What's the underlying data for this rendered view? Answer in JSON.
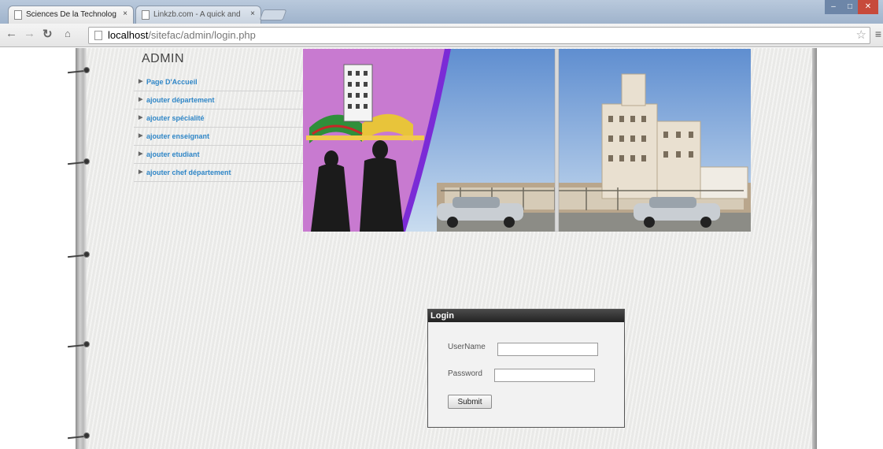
{
  "browser": {
    "tabs": [
      {
        "title": "Sciences De la Technolog",
        "active": true
      },
      {
        "title": "Linkzb.com - A quick and",
        "active": false
      }
    ],
    "tab_close_glyph": "×",
    "url_host": "localhost",
    "url_path": "/sitefac/admin/login.php",
    "back_icon": "back-arrow-icon",
    "forward_icon": "forward-arrow-icon",
    "reload_icon": "reload-icon",
    "home_icon": "home-icon"
  },
  "sidebar": {
    "title": "ADMIN",
    "items": [
      {
        "label": "Page D'Accueil"
      },
      {
        "label": "ajouter département"
      },
      {
        "label": "ajouter spécialité"
      },
      {
        "label": "ajouter enseignant"
      },
      {
        "label": "ajouter etudiant"
      },
      {
        "label": "ajouter chef département"
      }
    ]
  },
  "login": {
    "header": "Login",
    "username_label": "UserName",
    "username_value": "",
    "password_label": "Password",
    "password_value": "",
    "submit_label": "Submit"
  },
  "colors": {
    "link": "#2f86c7",
    "login_header": "#2a2a2a",
    "banner_purple": "#c87ad0",
    "banner_arc": "#7b2bd6"
  }
}
